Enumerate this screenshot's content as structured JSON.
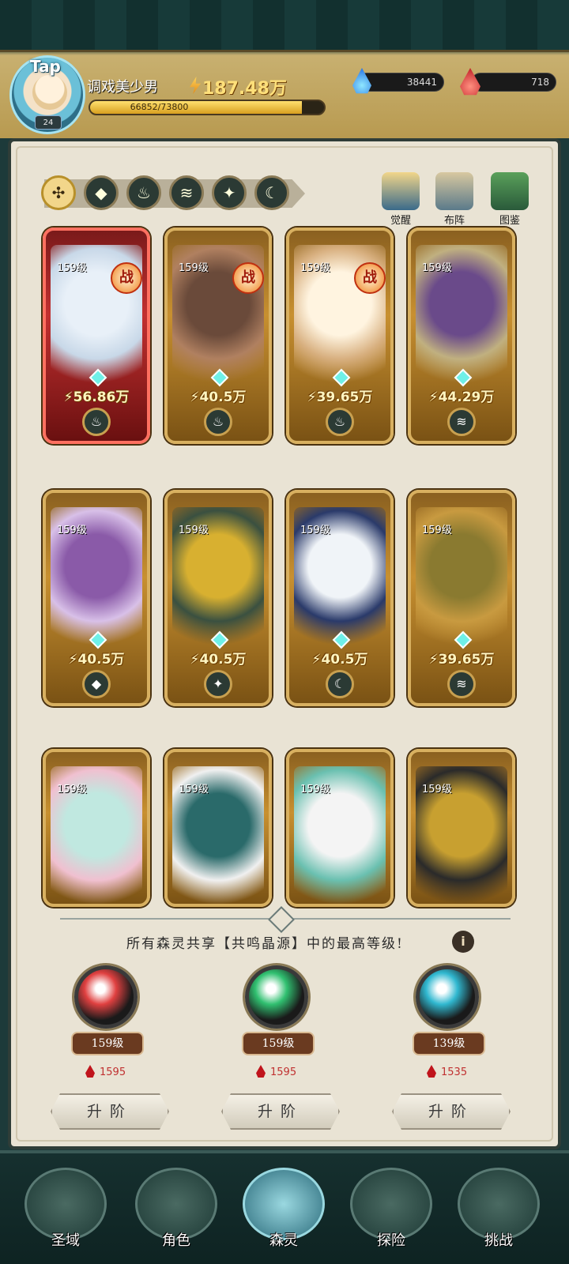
{
  "header": {
    "tap_label": "Tap",
    "player_level": "24",
    "player_name": "调戏美少男",
    "power": "187.48万",
    "exp_text": "66852/73800",
    "exp_progress": 0.906,
    "blue_resource": "38441",
    "red_resource": "718"
  },
  "filters": [
    {
      "name": "all",
      "icon": "grid-icon"
    },
    {
      "name": "water",
      "icon": "water-icon"
    },
    {
      "name": "fire",
      "icon": "fire-icon"
    },
    {
      "name": "wind",
      "icon": "wind-icon"
    },
    {
      "name": "light",
      "icon": "star-icon"
    },
    {
      "name": "dark",
      "icon": "moon-icon"
    }
  ],
  "corner_buttons": {
    "awaken": "觉醒",
    "formation": "布阵",
    "codex": "图鉴"
  },
  "cards": [
    {
      "level": "159级",
      "power": "56.86万",
      "battle": "战",
      "element": "fire",
      "colors": [
        "#e8f0f8",
        "#c8d8e8"
      ]
    },
    {
      "level": "159级",
      "power": "40.5万",
      "battle": "战",
      "element": "fire",
      "colors": [
        "#6a4a3a",
        "#b08060"
      ]
    },
    {
      "level": "159级",
      "power": "39.65万",
      "battle": "战",
      "element": "fire",
      "colors": [
        "#fff4e0",
        "#d8b080"
      ]
    },
    {
      "level": "159级",
      "power": "44.29万",
      "battle": "",
      "element": "wind",
      "colors": [
        "#6a4a8a",
        "#c0b080"
      ]
    },
    {
      "level": "159级",
      "power": "40.5万",
      "battle": "",
      "element": "water",
      "colors": [
        "#8a5aa8",
        "#d8c0e8"
      ]
    },
    {
      "level": "159级",
      "power": "40.5万",
      "battle": "",
      "element": "light",
      "colors": [
        "#d8b030",
        "#3a5040"
      ]
    },
    {
      "level": "159级",
      "power": "40.5万",
      "battle": "",
      "element": "dark",
      "colors": [
        "#f0f4f8",
        "#2a3a6a"
      ]
    },
    {
      "level": "159级",
      "power": "39.65万",
      "battle": "",
      "element": "wind",
      "colors": [
        "#8a7a30",
        "#c89a40"
      ]
    },
    {
      "level": "159级",
      "power": "",
      "battle": "",
      "element": "",
      "colors": [
        "#c0e8e0",
        "#f0c0d0"
      ]
    },
    {
      "level": "159级",
      "power": "",
      "battle": "",
      "element": "",
      "colors": [
        "#2a6a6a",
        "#f0f0f0"
      ]
    },
    {
      "level": "159级",
      "power": "",
      "battle": "",
      "element": "",
      "colors": [
        "#f4f4f4",
        "#6ac0b0"
      ]
    },
    {
      "level": "159级",
      "power": "",
      "battle": "",
      "element": "",
      "colors": [
        "#c8a030",
        "#2a2a2a"
      ]
    }
  ],
  "info_text": "所有森灵共享【共鸣晶源】中的最高等级!",
  "info_icon": "i",
  "orbs": [
    {
      "level": "159级",
      "cost": "1595",
      "button": "升阶",
      "color": "#e04040"
    },
    {
      "level": "159级",
      "cost": "1595",
      "button": "升阶",
      "color": "#30c070"
    },
    {
      "level": "139级",
      "cost": "1535",
      "button": "升阶",
      "color": "#30b8d0"
    }
  ],
  "nav": [
    {
      "label": "圣域",
      "icon": "tree-icon",
      "active": false
    },
    {
      "label": "角色",
      "icon": "character-icon",
      "active": false
    },
    {
      "label": "森灵",
      "icon": "spirit-icon",
      "active": true
    },
    {
      "label": "探险",
      "icon": "shield-icon",
      "active": false
    },
    {
      "label": "挑战",
      "icon": "sword-icon",
      "active": false
    }
  ]
}
